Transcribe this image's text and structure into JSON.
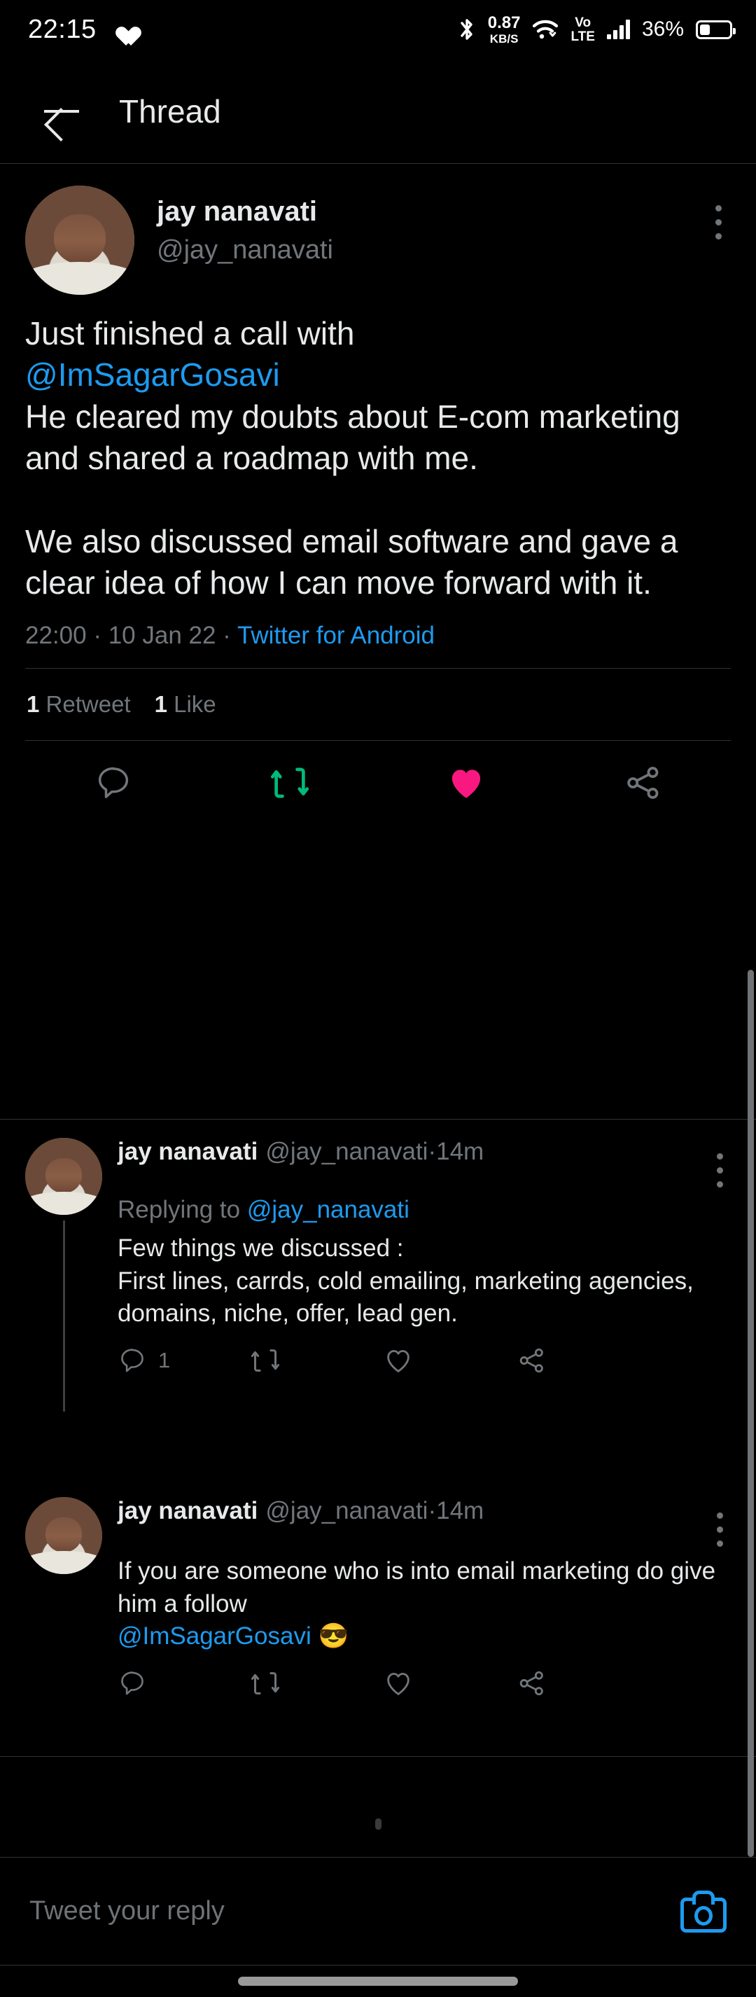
{
  "status_bar": {
    "time": "22:15",
    "health_icon": "heart-health-icon",
    "bluetooth_icon": "bluetooth-icon",
    "net_speed_value": "0.87",
    "net_speed_unit": "KB/S",
    "wifi_icon": "wifi-icon",
    "volte_line1": "Vo",
    "volte_line2": "LTE",
    "signal_icon": "cellular-signal-icon",
    "battery_percent": "36%",
    "battery_icon": "battery-icon"
  },
  "header": {
    "back_icon": "back-arrow-icon",
    "title": "Thread"
  },
  "main_tweet": {
    "author_name": "jay nanavati",
    "author_handle": "@jay_nanavati",
    "avatar_alt": "jay nanavati profile photo",
    "more_icon": "kebab-menu-icon",
    "body_part1": "Just finished a call with\n",
    "body_mention": "@ImSagarGosavi",
    "body_part2": "\nHe cleared my doubts about E-com marketing and shared a roadmap with me.\n\nWe also discussed email software and gave a clear idea of how I can move forward with it.",
    "time": "22:00",
    "date": "10 Jan 22",
    "separator": " · ",
    "source": "Twitter for Android",
    "retweet_count": "1",
    "retweet_label": "Retweet",
    "like_count": "1",
    "like_label": "Like",
    "actions": {
      "reply_icon": "reply-icon",
      "retweet_icon": "retweet-icon",
      "like_icon": "like-heart-icon",
      "share_icon": "share-icon"
    }
  },
  "replies": [
    {
      "author_name": "jay nanavati",
      "author_handle": "@jay_nanavati",
      "time_separator": " · ",
      "time": "14m",
      "replying_to_label": "Replying to ",
      "replying_to_handle": "@jay_nanavati",
      "text": "Few things we discussed :\nFirst lines, carrds, cold emailing, marketing agencies, domains, niche, offer, lead gen.",
      "mention": "",
      "emoji": "",
      "reply_count": "1",
      "retweet_count": "",
      "like_count": "",
      "more_icon": "kebab-menu-icon"
    },
    {
      "author_name": "jay nanavati",
      "author_handle": "@jay_nanavati",
      "time_separator": " · ",
      "time": "14m",
      "replying_to_label": "",
      "replying_to_handle": "",
      "text": "If you are someone who is into email marketing do give him a follow\n",
      "mention": "@ImSagarGosavi",
      "emoji": " 😎",
      "reply_count": "",
      "retweet_count": "",
      "like_count": "",
      "more_icon": "kebab-menu-icon"
    }
  ],
  "loading": {
    "indicator": "loading-dot"
  },
  "composer": {
    "placeholder": "Tweet your reply",
    "camera_icon": "camera-icon"
  },
  "colors": {
    "background": "#000000",
    "text_primary": "#e7e9ea",
    "text_secondary": "#71767b",
    "accent_blue": "#1d9bf0",
    "retweet_green": "#00ba7c",
    "like_pink": "#f91880",
    "divider": "#2f3336"
  }
}
